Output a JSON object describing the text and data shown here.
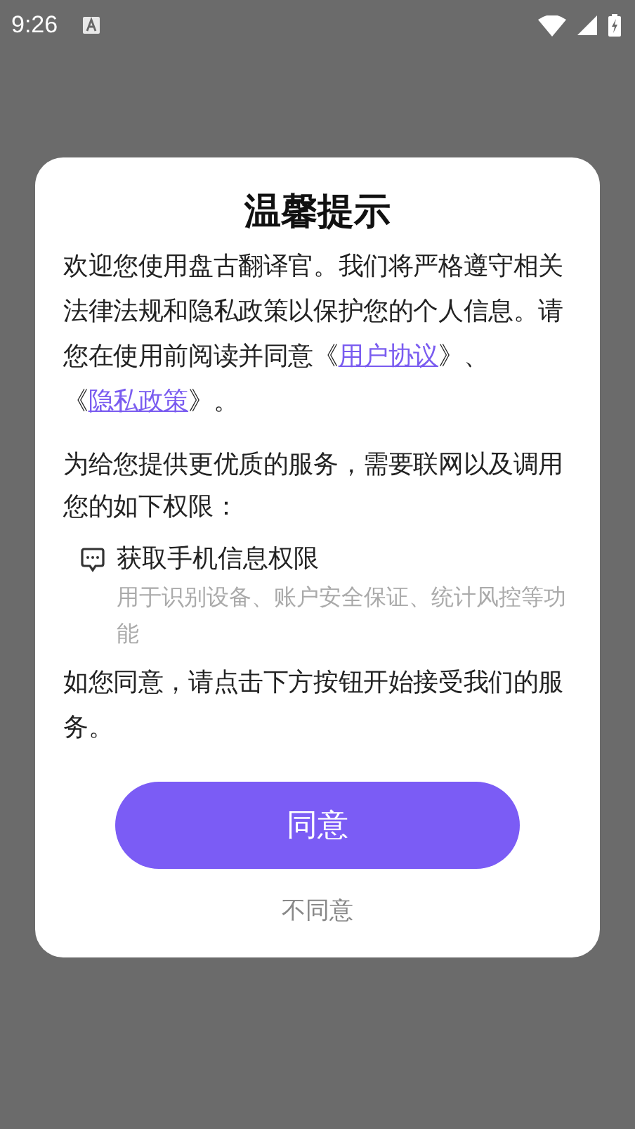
{
  "status_bar": {
    "time": "9:26"
  },
  "dialog": {
    "title": "温馨提示",
    "consent": [
      {
        "kind": "text",
        "text": "欢迎您使用盘古翻译官。我们将严格遵守相关法律法规和隐私政策以保护您的个人信息。请您在使用前阅读并同意《"
      },
      {
        "kind": "link",
        "text": "用户协议"
      },
      {
        "kind": "text",
        "text": "》、《"
      },
      {
        "kind": "link",
        "text": "隐私政策"
      },
      {
        "kind": "text",
        "text": "》。"
      }
    ],
    "intro": "为给您提供更优质的服务，需要联网以及调用您的如下权限：",
    "permissions": [
      {
        "title": "获取手机信息权限",
        "description": "用于识别设备、账户安全保证、统计风控等功能"
      }
    ],
    "closing": "如您同意，请点击下方按钮开始接受我们的服务。",
    "agree_button": "同意",
    "decline_button": "不同意"
  }
}
